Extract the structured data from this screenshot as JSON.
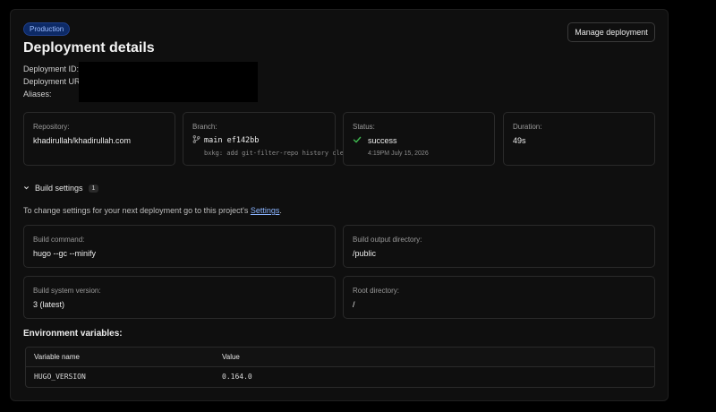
{
  "badge": "Production",
  "title": "Deployment details",
  "meta": {
    "deployment_id_label": "Deployment ID:",
    "deployment_url_label": "Deployment URL:",
    "aliases_label": "Aliases:"
  },
  "manage_button": "Manage deployment",
  "cards": {
    "repository": {
      "label": "Repository:",
      "value": "khadirullah/khadirullah.com"
    },
    "branch": {
      "label": "Branch:",
      "value": "main ef142bb",
      "commit_message": "bxkg: add git-filter-repo history cle..."
    },
    "status": {
      "label": "Status:",
      "value": "success",
      "time": "4:19PM July 15, 2026"
    },
    "duration": {
      "label": "Duration:",
      "value": "49s"
    }
  },
  "build_settings": {
    "title": "Build settings",
    "count": "1",
    "hint_prefix": "To change settings for your next deployment go to this project's ",
    "hint_link": "Settings",
    "hint_suffix": ".",
    "command": {
      "label": "Build command:",
      "value": "hugo --gc --minify"
    },
    "output_dir": {
      "label": "Build output directory:",
      "value": "/public"
    },
    "system_version": {
      "label": "Build system version:",
      "value": "3 (latest)"
    },
    "root_dir": {
      "label": "Root directory:",
      "value": "/"
    }
  },
  "env": {
    "title": "Environment variables:",
    "columns": [
      "Variable name",
      "Value"
    ],
    "rows": [
      [
        "HUGO_VERSION",
        "0.164.0"
      ]
    ]
  },
  "colors": {
    "badge_bg": "#0d2a66",
    "success": "#3fb950",
    "link": "#8ab4ff"
  },
  "icons": [
    "chevron-down-icon",
    "git-branch-icon",
    "check-icon"
  ]
}
